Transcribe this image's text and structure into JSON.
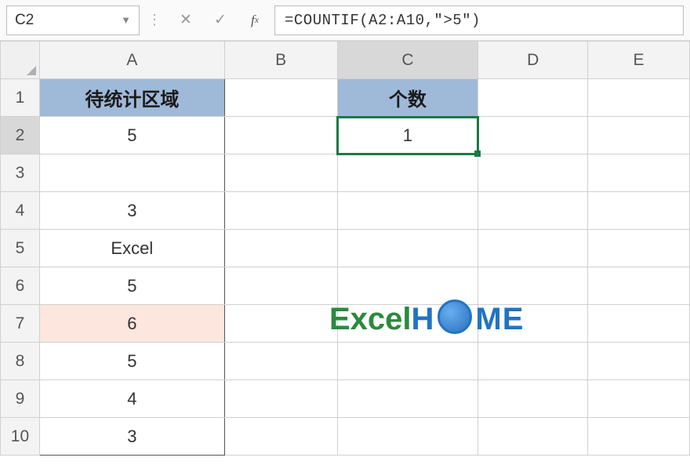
{
  "formula_bar": {
    "name_box": "C2",
    "formula": "=COUNTIF(A2:A10,\">5\")"
  },
  "columns": [
    "A",
    "B",
    "C",
    "D",
    "E"
  ],
  "rows": [
    "1",
    "2",
    "3",
    "4",
    "5",
    "6",
    "7",
    "8",
    "9",
    "10"
  ],
  "active_cell": "C2",
  "headers": {
    "A1": "待统计区域",
    "C1": "个数"
  },
  "cells": {
    "A2": "5",
    "A3": "",
    "A4": "3",
    "A5": "Excel",
    "A6": "5",
    "A7": "6",
    "A8": "5",
    "A9": "4",
    "A10": "3",
    "C2": "1"
  },
  "watermark": {
    "part1": "Excel",
    "part2": "H",
    "part3": "ME"
  },
  "chart_data": {
    "type": "table",
    "title": "待统计区域",
    "result_label": "个数",
    "data_range": "A2:A10",
    "values": [
      "5",
      "",
      "3",
      "Excel",
      "5",
      "6",
      "5",
      "4",
      "3"
    ],
    "formula": "=COUNTIF(A2:A10,\">5\")",
    "result": 1
  }
}
